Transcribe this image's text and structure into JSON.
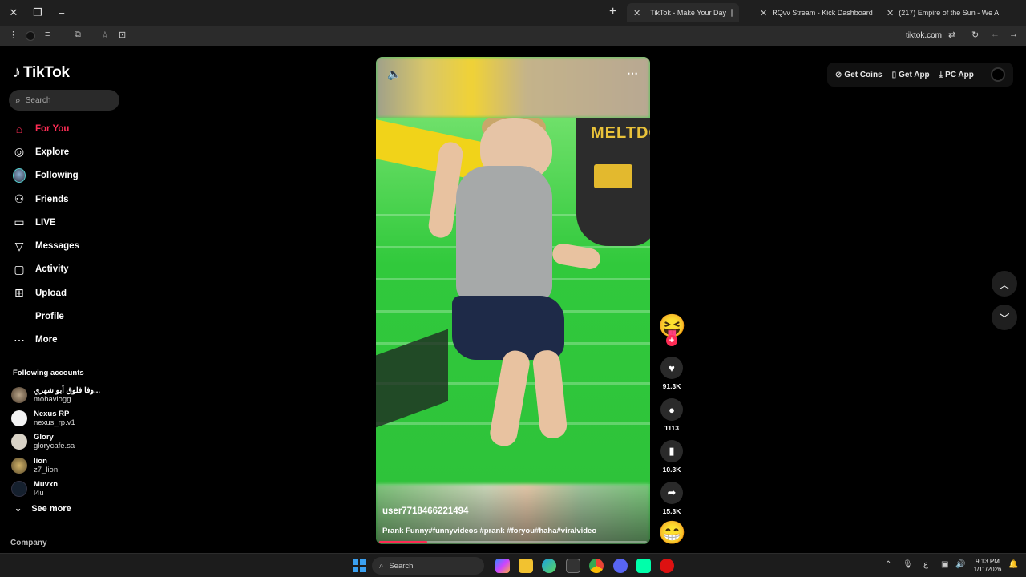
{
  "browser": {
    "tabs": [
      {
        "title": "TikTok - Make Your Day",
        "active": true
      },
      {
        "title": "RQvv Stream - Kick Dashboard",
        "active": false
      },
      {
        "title": "(217) Empire of the Sun - We A",
        "active": false
      }
    ],
    "url": "tiktok.com"
  },
  "sidebar": {
    "logo_text": "TikTok",
    "search_placeholder": "Search",
    "nav": [
      {
        "label": "For You",
        "icon": "home-icon",
        "active": true
      },
      {
        "label": "Explore",
        "icon": "compass-icon",
        "active": false
      },
      {
        "label": "Following",
        "icon": "avatar",
        "active": false
      },
      {
        "label": "Friends",
        "icon": "friends-icon",
        "active": false
      },
      {
        "label": "LIVE",
        "icon": "live-icon",
        "active": false
      },
      {
        "label": "Messages",
        "icon": "messages-icon",
        "active": false
      },
      {
        "label": "Activity",
        "icon": "activity-icon",
        "active": false
      },
      {
        "label": "Upload",
        "icon": "upload-icon",
        "active": false
      },
      {
        "label": "Profile",
        "icon": "profile-icon",
        "active": false
      },
      {
        "label": "More",
        "icon": "more-icon",
        "active": false
      }
    ],
    "following_title": "Following accounts",
    "accounts": [
      {
        "display": "وفا فلوق أبو شهري...",
        "handle": "mohavlogg",
        "color": "#7a6a5a"
      },
      {
        "display": "Nexus RP",
        "handle": "nexus_rp.v1",
        "color": "#f2f2f2"
      },
      {
        "display": "Glory",
        "handle": "glorycafe.sa",
        "color": "#c9c2b4"
      },
      {
        "display": "lion",
        "handle": "z7_lion",
        "color": "#8a7a4a"
      },
      {
        "display": "Muvxn",
        "handle": "l4u",
        "color": "#1e2a3a"
      }
    ],
    "see_more": "See more",
    "company": "Company"
  },
  "video": {
    "author": "user7718466221494",
    "caption": "Prank Funny#funnyvideos #prank #foryou#haha#viralvideo",
    "progress": 0.18,
    "machine_label": "MELTDO"
  },
  "actions": {
    "avatar_emoji": "😝",
    "likes": "91.3K",
    "comments": "1113",
    "saves": "10.3K",
    "shares": "15.3K",
    "music_emoji": "😁"
  },
  "header": {
    "get_coins": "Get Coins",
    "get_app": "Get App",
    "pc_app": "PC App"
  },
  "taskbar": {
    "search": "Search",
    "time": "9:13 PM",
    "date": "1/11/2026"
  },
  "colors": {
    "accent": "#fe2c55",
    "background": "#000000"
  }
}
